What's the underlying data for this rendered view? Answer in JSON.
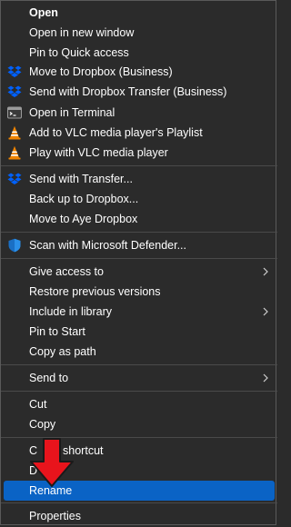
{
  "menu": {
    "items": [
      {
        "label": "Open"
      },
      {
        "label": "Open in new window"
      },
      {
        "label": "Pin to Quick access"
      },
      {
        "label": "Move to Dropbox (Business)",
        "icon": "dropbox-icon"
      },
      {
        "label": "Send with Dropbox Transfer (Business)",
        "icon": "dropbox-icon"
      },
      {
        "label": "Open in Terminal",
        "icon": "terminal-icon"
      },
      {
        "label": "Add to VLC media player's Playlist",
        "icon": "vlc-icon"
      },
      {
        "label": "Play with VLC media player",
        "icon": "vlc-icon"
      },
      {
        "label": "Send with Transfer...",
        "icon": "dropbox-icon"
      },
      {
        "label": "Back up to Dropbox..."
      },
      {
        "label": "Move to Aye Dropbox"
      },
      {
        "label": "Scan with Microsoft Defender...",
        "icon": "defender-shield-icon"
      },
      {
        "label": "Give access to",
        "submenu": true
      },
      {
        "label": "Restore previous versions"
      },
      {
        "label": "Include in library",
        "submenu": true
      },
      {
        "label": "Pin to Start"
      },
      {
        "label": "Copy as path"
      },
      {
        "label": "Send to",
        "submenu": true
      },
      {
        "label": "Cut"
      },
      {
        "label": "Copy"
      },
      {
        "label": "Create shortcut",
        "visible_text": "C",
        "visible_text_after": "shortcut"
      },
      {
        "label": "Delete",
        "visible_text": "D"
      },
      {
        "label": "Rename",
        "selected": true
      },
      {
        "label": "Properties"
      }
    ]
  },
  "colors": {
    "background": "#2b2b2b",
    "selected": "#0a63c5",
    "arrow": "#e8141c",
    "dropbox": "#0061fe",
    "vlc": "#f28500"
  }
}
